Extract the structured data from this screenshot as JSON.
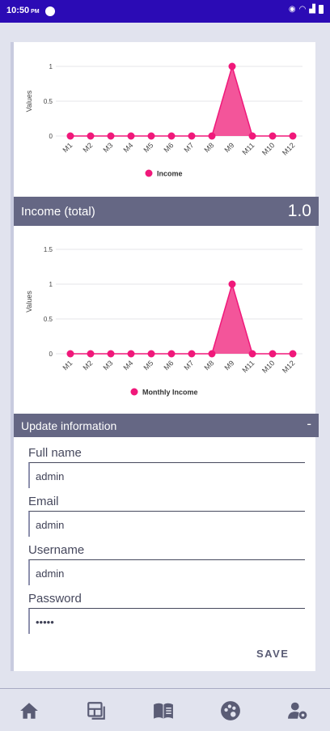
{
  "status_bar": {
    "time": "10:50",
    "ampm": "PM"
  },
  "chart_data": [
    {
      "type": "area",
      "categories": [
        "M1",
        "M2",
        "M3",
        "M4",
        "M5",
        "M6",
        "M7",
        "M8",
        "M9",
        "M11",
        "M10",
        "M12"
      ],
      "series": [
        {
          "name": "Income",
          "values": [
            0,
            0,
            0,
            0,
            0,
            0,
            0,
            0,
            1,
            0,
            0,
            0
          ]
        }
      ],
      "ylabel": "Values",
      "yticks": [
        "0",
        "0.5",
        "1"
      ],
      "ylim": [
        0,
        1
      ],
      "legend": "bottom-center",
      "color": "#f0187a",
      "fill": "#f3559a"
    },
    {
      "type": "area",
      "categories": [
        "M1",
        "M2",
        "M3",
        "M4",
        "M5",
        "M6",
        "M7",
        "M8",
        "M9",
        "M11",
        "M10",
        "M12"
      ],
      "series": [
        {
          "name": "Monthly Income",
          "values": [
            0,
            0,
            0,
            0,
            0,
            0,
            0,
            0,
            1,
            0,
            0,
            0
          ]
        }
      ],
      "ylabel": "Values",
      "yticks": [
        "0",
        "0.5",
        "1",
        "1.5"
      ],
      "ylim": [
        0,
        1.5
      ],
      "legend": "bottom-center",
      "color": "#f0187a",
      "fill": "#f3559a"
    }
  ],
  "income_total": {
    "label": "Income (total)",
    "value": "1.0"
  },
  "update_info": {
    "title": "Update information",
    "toggle": "-",
    "fields": [
      {
        "label": "Full name",
        "value": "admin"
      },
      {
        "label": "Email",
        "value": "admin"
      },
      {
        "label": "Username",
        "value": "admin"
      },
      {
        "label": "Password",
        "value": "•••••"
      }
    ],
    "save_label": "SAVE"
  },
  "nav": [
    "home-icon",
    "dashboard-icon",
    "book-icon",
    "palette-icon",
    "user-settings-icon"
  ]
}
